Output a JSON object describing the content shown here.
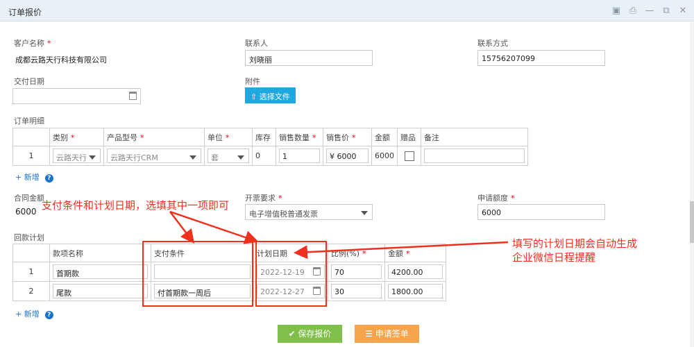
{
  "window": {
    "title": "订单报价"
  },
  "form": {
    "customer_label": "客户名称",
    "customer_value": "成都云路天行科技有限公司",
    "contact_label": "联系人",
    "contact_value": "刘晓丽",
    "contact_method_label": "联系方式",
    "contact_method_value": "15756207099",
    "delivery_date_label": "交付日期",
    "delivery_date_value": "",
    "attachment_label": "附件",
    "choose_file_label": "选择文件",
    "order_detail_label": "订单明细",
    "contract_amount_label": "合同金额",
    "contract_amount_value": "6000",
    "invoice_label": "开票要求",
    "invoice_value": "电子增值税普通发票",
    "apply_amount_label": "申请额度",
    "apply_amount_value": "6000",
    "payment_plan_label": "回款计划",
    "add_label": "+ 新增",
    "required_mark": "*"
  },
  "order_table": {
    "headers": [
      "类别",
      "产品型号",
      "单位",
      "库存",
      "销售数量",
      "销售价",
      "金额",
      "赠品",
      "备注"
    ],
    "rows": [
      {
        "index": "1",
        "category": "云路天行",
        "model": "云路天行CRM",
        "unit": "套",
        "stock": "0",
        "quantity": "1",
        "price": "¥  6000",
        "amount": "6000",
        "gift": false,
        "remark": ""
      }
    ]
  },
  "payment_table": {
    "headers": [
      "款项名称",
      "支付条件",
      "计划日期",
      "比例(%)",
      "金额"
    ],
    "rows": [
      {
        "index": "1",
        "name": "首期款",
        "condition": "",
        "date": "2022-12-19",
        "ratio": "70",
        "amount": "4200.00"
      },
      {
        "index": "2",
        "name": "尾款",
        "condition": "付首期款一周后",
        "date": "2022-12-27",
        "ratio": "30",
        "amount": "1800.00"
      }
    ]
  },
  "annotations": {
    "left": "支付条件和计划日期，选填其中一项即可",
    "right_line1": "填写的计划日期会自动生成",
    "right_line2": "企业微信日程提醒"
  },
  "footer": {
    "save_label": "✔ 保存报价",
    "apply_label": "☰ 申请签单"
  },
  "colors": {
    "annotation": "#f0301f",
    "save": "#7fbf4a",
    "apply": "#f6a44b",
    "upload": "#1fa8e0",
    "link": "#1a73c9"
  }
}
